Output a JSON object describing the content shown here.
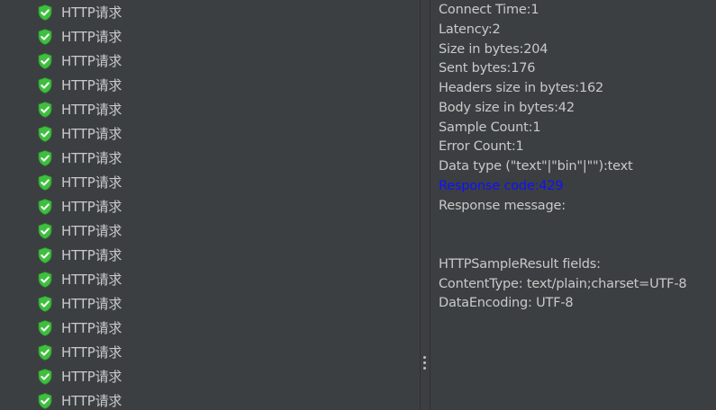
{
  "sample_tree": {
    "items": [
      {
        "label": "HTTP请求",
        "status": "success"
      },
      {
        "label": "HTTP请求",
        "status": "success"
      },
      {
        "label": "HTTP请求",
        "status": "success"
      },
      {
        "label": "HTTP请求",
        "status": "success"
      },
      {
        "label": "HTTP请求",
        "status": "success"
      },
      {
        "label": "HTTP请求",
        "status": "success"
      },
      {
        "label": "HTTP请求",
        "status": "success"
      },
      {
        "label": "HTTP请求",
        "status": "success"
      },
      {
        "label": "HTTP请求",
        "status": "success"
      },
      {
        "label": "HTTP请求",
        "status": "success"
      },
      {
        "label": "HTTP请求",
        "status": "success"
      },
      {
        "label": "HTTP请求",
        "status": "success"
      },
      {
        "label": "HTTP请求",
        "status": "success"
      },
      {
        "label": "HTTP请求",
        "status": "success"
      },
      {
        "label": "HTTP请求",
        "status": "success"
      },
      {
        "label": "HTTP请求",
        "status": "success"
      },
      {
        "label": "HTTP请求",
        "status": "success"
      }
    ],
    "icon": "green-shield-check-icon"
  },
  "sampler_result": {
    "lines": [
      "Connect Time:1",
      "Latency:2",
      "Size in bytes:204",
      "Sent bytes:176",
      "Headers size in bytes:162",
      "Body size in bytes:42",
      "Sample Count:1",
      "Error Count:1",
      "Data type (\"text\"|\"bin\"|\"\"):text",
      "Response code:429",
      "Response message:",
      "",
      "",
      "HTTPSampleResult fields:",
      "ContentType: text/plain;charset=UTF-8",
      "DataEncoding: UTF-8"
    ],
    "highlighted_line": "Response code:429"
  },
  "colors": {
    "background": "#3c3f41",
    "text": "#c9c9c9",
    "highlight": "#1010ff",
    "success_icon": "#3fbf3f"
  }
}
